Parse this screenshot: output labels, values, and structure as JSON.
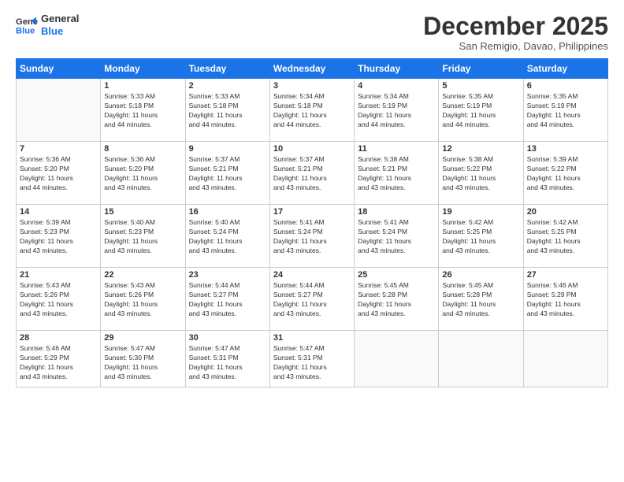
{
  "logo": {
    "line1": "General",
    "line2": "Blue"
  },
  "title": "December 2025",
  "location": "San Remigio, Davao, Philippines",
  "days_of_week": [
    "Sunday",
    "Monday",
    "Tuesday",
    "Wednesday",
    "Thursday",
    "Friday",
    "Saturday"
  ],
  "weeks": [
    [
      {
        "day": "",
        "info": ""
      },
      {
        "day": "1",
        "info": "Sunrise: 5:33 AM\nSunset: 5:18 PM\nDaylight: 11 hours\nand 44 minutes."
      },
      {
        "day": "2",
        "info": "Sunrise: 5:33 AM\nSunset: 5:18 PM\nDaylight: 11 hours\nand 44 minutes."
      },
      {
        "day": "3",
        "info": "Sunrise: 5:34 AM\nSunset: 5:18 PM\nDaylight: 11 hours\nand 44 minutes."
      },
      {
        "day": "4",
        "info": "Sunrise: 5:34 AM\nSunset: 5:19 PM\nDaylight: 11 hours\nand 44 minutes."
      },
      {
        "day": "5",
        "info": "Sunrise: 5:35 AM\nSunset: 5:19 PM\nDaylight: 11 hours\nand 44 minutes."
      },
      {
        "day": "6",
        "info": "Sunrise: 5:35 AM\nSunset: 5:19 PM\nDaylight: 11 hours\nand 44 minutes."
      }
    ],
    [
      {
        "day": "7",
        "info": "Sunrise: 5:36 AM\nSunset: 5:20 PM\nDaylight: 11 hours\nand 44 minutes."
      },
      {
        "day": "8",
        "info": "Sunrise: 5:36 AM\nSunset: 5:20 PM\nDaylight: 11 hours\nand 43 minutes."
      },
      {
        "day": "9",
        "info": "Sunrise: 5:37 AM\nSunset: 5:21 PM\nDaylight: 11 hours\nand 43 minutes."
      },
      {
        "day": "10",
        "info": "Sunrise: 5:37 AM\nSunset: 5:21 PM\nDaylight: 11 hours\nand 43 minutes."
      },
      {
        "day": "11",
        "info": "Sunrise: 5:38 AM\nSunset: 5:21 PM\nDaylight: 11 hours\nand 43 minutes."
      },
      {
        "day": "12",
        "info": "Sunrise: 5:38 AM\nSunset: 5:22 PM\nDaylight: 11 hours\nand 43 minutes."
      },
      {
        "day": "13",
        "info": "Sunrise: 5:39 AM\nSunset: 5:22 PM\nDaylight: 11 hours\nand 43 minutes."
      }
    ],
    [
      {
        "day": "14",
        "info": "Sunrise: 5:39 AM\nSunset: 5:23 PM\nDaylight: 11 hours\nand 43 minutes."
      },
      {
        "day": "15",
        "info": "Sunrise: 5:40 AM\nSunset: 5:23 PM\nDaylight: 11 hours\nand 43 minutes."
      },
      {
        "day": "16",
        "info": "Sunrise: 5:40 AM\nSunset: 5:24 PM\nDaylight: 11 hours\nand 43 minutes."
      },
      {
        "day": "17",
        "info": "Sunrise: 5:41 AM\nSunset: 5:24 PM\nDaylight: 11 hours\nand 43 minutes."
      },
      {
        "day": "18",
        "info": "Sunrise: 5:41 AM\nSunset: 5:24 PM\nDaylight: 11 hours\nand 43 minutes."
      },
      {
        "day": "19",
        "info": "Sunrise: 5:42 AM\nSunset: 5:25 PM\nDaylight: 11 hours\nand 43 minutes."
      },
      {
        "day": "20",
        "info": "Sunrise: 5:42 AM\nSunset: 5:25 PM\nDaylight: 11 hours\nand 43 minutes."
      }
    ],
    [
      {
        "day": "21",
        "info": "Sunrise: 5:43 AM\nSunset: 5:26 PM\nDaylight: 11 hours\nand 43 minutes."
      },
      {
        "day": "22",
        "info": "Sunrise: 5:43 AM\nSunset: 5:26 PM\nDaylight: 11 hours\nand 43 minutes."
      },
      {
        "day": "23",
        "info": "Sunrise: 5:44 AM\nSunset: 5:27 PM\nDaylight: 11 hours\nand 43 minutes."
      },
      {
        "day": "24",
        "info": "Sunrise: 5:44 AM\nSunset: 5:27 PM\nDaylight: 11 hours\nand 43 minutes."
      },
      {
        "day": "25",
        "info": "Sunrise: 5:45 AM\nSunset: 5:28 PM\nDaylight: 11 hours\nand 43 minutes."
      },
      {
        "day": "26",
        "info": "Sunrise: 5:45 AM\nSunset: 5:28 PM\nDaylight: 11 hours\nand 43 minutes."
      },
      {
        "day": "27",
        "info": "Sunrise: 5:46 AM\nSunset: 5:29 PM\nDaylight: 11 hours\nand 43 minutes."
      }
    ],
    [
      {
        "day": "28",
        "info": "Sunrise: 5:46 AM\nSunset: 5:29 PM\nDaylight: 11 hours\nand 43 minutes."
      },
      {
        "day": "29",
        "info": "Sunrise: 5:47 AM\nSunset: 5:30 PM\nDaylight: 11 hours\nand 43 minutes."
      },
      {
        "day": "30",
        "info": "Sunrise: 5:47 AM\nSunset: 5:31 PM\nDaylight: 11 hours\nand 43 minutes."
      },
      {
        "day": "31",
        "info": "Sunrise: 5:47 AM\nSunset: 5:31 PM\nDaylight: 11 hours\nand 43 minutes."
      },
      {
        "day": "",
        "info": ""
      },
      {
        "day": "",
        "info": ""
      },
      {
        "day": "",
        "info": ""
      }
    ]
  ]
}
